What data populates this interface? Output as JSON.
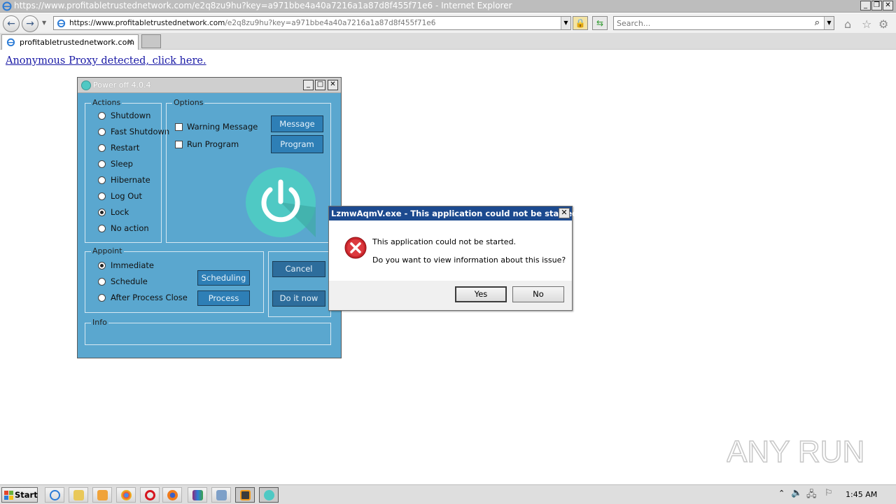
{
  "browser": {
    "window_title": "https://www.profitabletrustednetwork.com/e2q8zu9hu?key=a971bbe4a40a7216a1a87d8f455f71e6 - Internet Explorer",
    "url_prefix": "https://www.",
    "url_domain": "profitabletrustednetwork.com",
    "url_rest": "/e2q8zu9hu?key=a971bbe4a40a7216a1a87d8f455f71e6",
    "search_placeholder": "Search...",
    "tab_label": "profitabletrustednetwork.com"
  },
  "page": {
    "proxy_link": "Anonymous Proxy detected, click here."
  },
  "poweroff": {
    "title": "Power off 4.0.4",
    "actions_label": "Actions",
    "actions": [
      {
        "label": "Shutdown",
        "selected": false
      },
      {
        "label": "Fast Shutdown",
        "selected": false
      },
      {
        "label": "Restart",
        "selected": false
      },
      {
        "label": "Sleep",
        "selected": false
      },
      {
        "label": "Hibernate",
        "selected": false
      },
      {
        "label": "Log Out",
        "selected": false
      },
      {
        "label": "Lock",
        "selected": true
      },
      {
        "label": "No action",
        "selected": false
      }
    ],
    "options_label": "Options",
    "warning_message": "Warning Message",
    "run_program": "Run Program",
    "message_btn": "Message",
    "program_btn": "Program",
    "appoint_label": "Appoint",
    "appoint": [
      {
        "label": "Immediate",
        "selected": true
      },
      {
        "label": "Schedule",
        "selected": false
      },
      {
        "label": "After Process Close",
        "selected": false
      }
    ],
    "scheduling_btn": "Scheduling",
    "process_btn": "Process",
    "cancel_btn": "Cancel",
    "doit_btn": "Do it now",
    "info_label": "Info"
  },
  "dialog": {
    "title": "LzmwAqmV.exe - This application could not be started.",
    "line1": "This application could not be started.",
    "line2": "Do you want to view information about this issue?",
    "yes": "Yes",
    "no": "No"
  },
  "taskbar": {
    "start": "Start",
    "clock": "1:45 AM"
  },
  "watermark": "ANY RUN"
}
